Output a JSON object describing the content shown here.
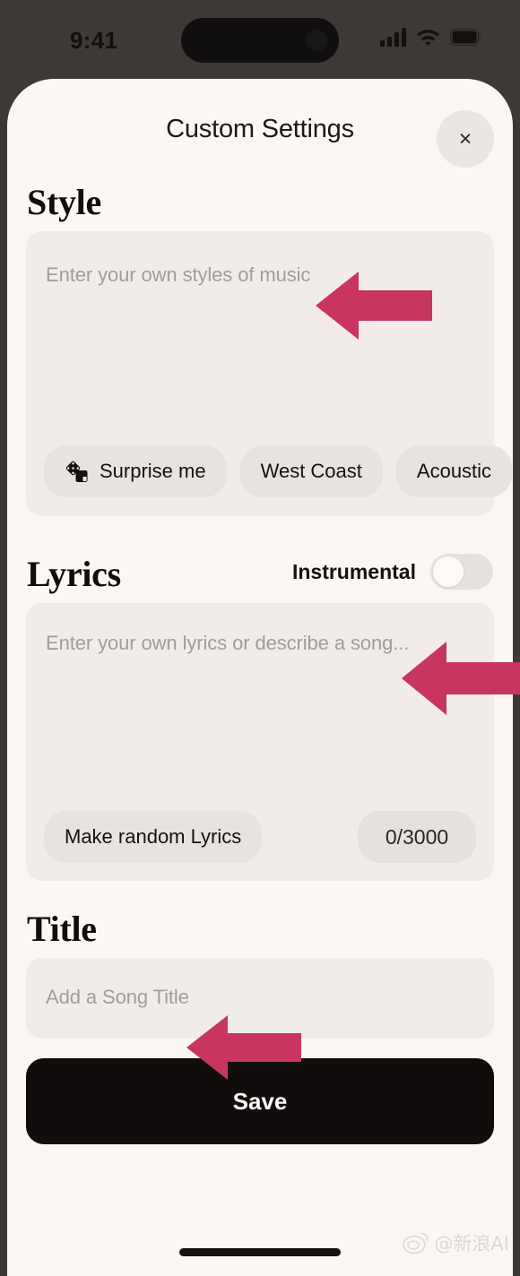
{
  "status_bar": {
    "time": "9:41",
    "icons": [
      "cellular-signal-icon",
      "wifi-icon",
      "battery-icon"
    ]
  },
  "header": {
    "title": "Custom Settings",
    "close_label": "×"
  },
  "style_section": {
    "title": "Style",
    "placeholder": "Enter your own styles of music",
    "chips": [
      {
        "label": "Surprise me",
        "icon": "dice-icon"
      },
      {
        "label": "West Coast",
        "icon": null
      },
      {
        "label": "Acoustic",
        "icon": null
      }
    ]
  },
  "lyrics_section": {
    "title": "Lyrics",
    "toggle_label": "Instrumental",
    "toggle_state": "off",
    "placeholder": "Enter your own lyrics or describe a song...",
    "random_button": "Make random Lyrics",
    "counter": "0/3000"
  },
  "title_section": {
    "title": "Title",
    "placeholder": "Add a Song Title"
  },
  "footer": {
    "save_label": "Save"
  },
  "watermark": {
    "text": "@新浪AI"
  },
  "colors": {
    "bezel": "#3e3836",
    "sheet_background": "#faf7f4",
    "card_background": "#f1ecea",
    "chip_background": "#e9e3e0",
    "accent_arrow": "#c8365f",
    "save_background": "#100d0c",
    "placeholder_text": "#a39c99"
  }
}
